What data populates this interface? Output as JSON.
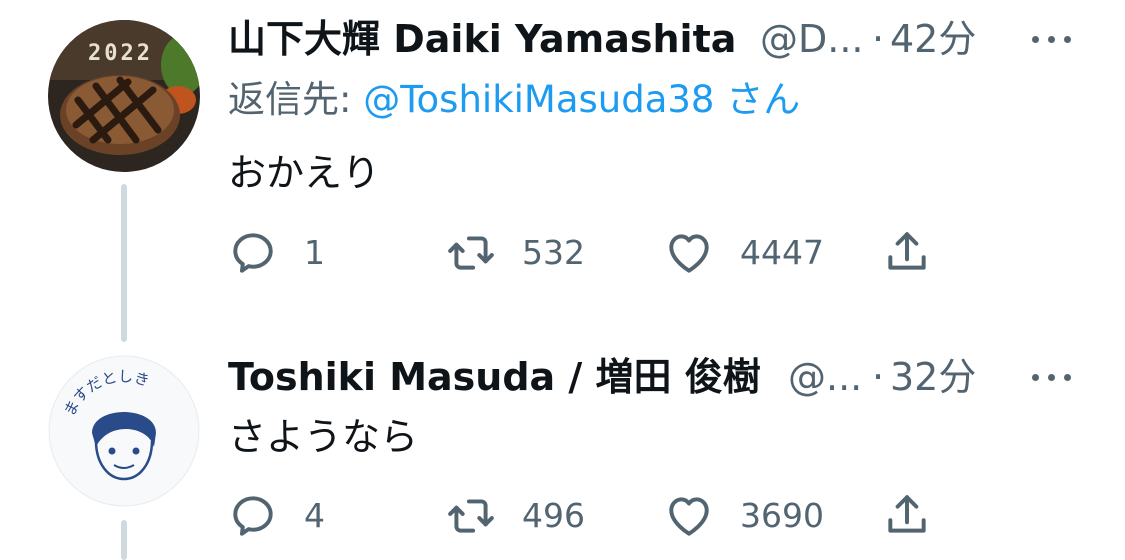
{
  "tweets": [
    {
      "name": "山下大輝 Daiki Yamashita",
      "handle": "@D...",
      "dot": "·",
      "time": "42分",
      "reply_to_prefix": "返信先: ",
      "reply_to_mention": "@ToshikiMasuda38",
      "reply_to_suffix": " さん",
      "text": "おかえり",
      "avatar_badge": "2022",
      "reply_count": "1",
      "retweet_count": "532",
      "like_count": "4447"
    },
    {
      "name": "Toshiki Masuda / 増田 俊樹",
      "handle": "@...",
      "dot": "·",
      "time": "32分",
      "text": "さようなら",
      "avatar_text": "ますだとしき",
      "reply_count": "4",
      "retweet_count": "496",
      "like_count": "3690"
    }
  ],
  "icons": {
    "reply": "reply-icon",
    "retweet": "retweet-icon",
    "like": "heart-icon",
    "share": "share-icon",
    "more": "more-icon"
  },
  "colors": {
    "text": "#0f1419",
    "secondary": "#536471",
    "mention": "#1d9bf0",
    "thread_line": "#cfd9de"
  }
}
